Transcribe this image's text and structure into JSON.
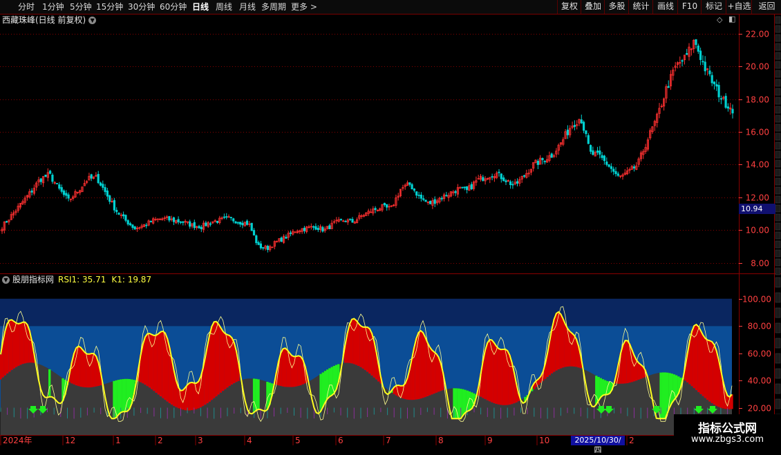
{
  "toolbar": {
    "periods": [
      "分时",
      "1分钟",
      "5分钟",
      "15分钟",
      "30分钟",
      "60分钟",
      "日线",
      "周线",
      "月线",
      "多周期",
      "更多 >"
    ],
    "active_period": "日线",
    "right_buttons": [
      "复权",
      "叠加",
      "多股",
      "统计",
      "画线",
      "F10",
      "标记",
      "+自选",
      "返回"
    ]
  },
  "main_panel": {
    "title": "西藏珠峰(日线 前复权)",
    "current_price_badge": "10.94"
  },
  "sub_panel": {
    "title": "股朋指标网",
    "rsi_label": "RSI1: 35.71",
    "k_label": "K1: 19.87"
  },
  "x_axis": {
    "labels": [
      "2024年",
      "12",
      "1",
      "2",
      "3",
      "4",
      "5",
      "6",
      "7",
      "8",
      "9",
      "10",
      "2025/10/30/四",
      "2"
    ]
  },
  "watermark": {
    "line1": "指标公式网",
    "line2": "www.zbgs3.com"
  },
  "colors": {
    "up": "#ff3030",
    "down": "#00d0d0",
    "grid": "#8a0000",
    "axis_text": "#ff4040",
    "fill_red": "#d40000",
    "fill_green": "#20ee20",
    "fill_blue": "#0b4d96",
    "fill_navy": "#0a2660",
    "gray": "#3a3a3a",
    "line_yellow": "#ffff20"
  },
  "chart_data": [
    {
      "type": "candlestick",
      "ylim": [
        7.6,
        22.8
      ],
      "y_ticks": [
        "8.00",
        "10.00",
        "12.00",
        "14.00",
        "16.00",
        "18.00",
        "20.00",
        "22.00"
      ],
      "close_series_approx": [
        10.2,
        10.9,
        11.6,
        12.3,
        13.1,
        13.4,
        12.5,
        11.8,
        12.4,
        13.1,
        13.2,
        12.2,
        11.2,
        10.6,
        10.1,
        10.3,
        10.6,
        10.7,
        10.6,
        10.5,
        10.3,
        10.2,
        10.5,
        10.6,
        10.7,
        10.5,
        10.4,
        9.0,
        8.9,
        9.3,
        9.6,
        10.0,
        10.1,
        10.2,
        10.0,
        10.4,
        10.6,
        10.5,
        10.9,
        11.2,
        11.4,
        11.3,
        12.5,
        12.8,
        12.0,
        11.6,
        11.9,
        12.2,
        12.5,
        12.4,
        13.0,
        13.3,
        13.5,
        13.1,
        12.7,
        13.3,
        14.0,
        14.3,
        14.6,
        15.4,
        16.4,
        16.9,
        14.7,
        14.5,
        13.9,
        13.2,
        13.5,
        14.0,
        15.5,
        16.8,
        18.6,
        20.0,
        20.5,
        21.6,
        20.0,
        18.9,
        17.9,
        17.4
      ],
      "indicator": {
        "type": "area",
        "ylim": [
          0,
          110
        ],
        "y_ticks": [
          "20.00",
          "40.00",
          "60.00",
          "80.00",
          "100.00"
        ],
        "series": [
          {
            "name": "RSI1",
            "last_value": 35.71
          },
          {
            "name": "K1",
            "last_value": 19.87
          }
        ],
        "arrow_markers_count": 7
      }
    }
  ]
}
